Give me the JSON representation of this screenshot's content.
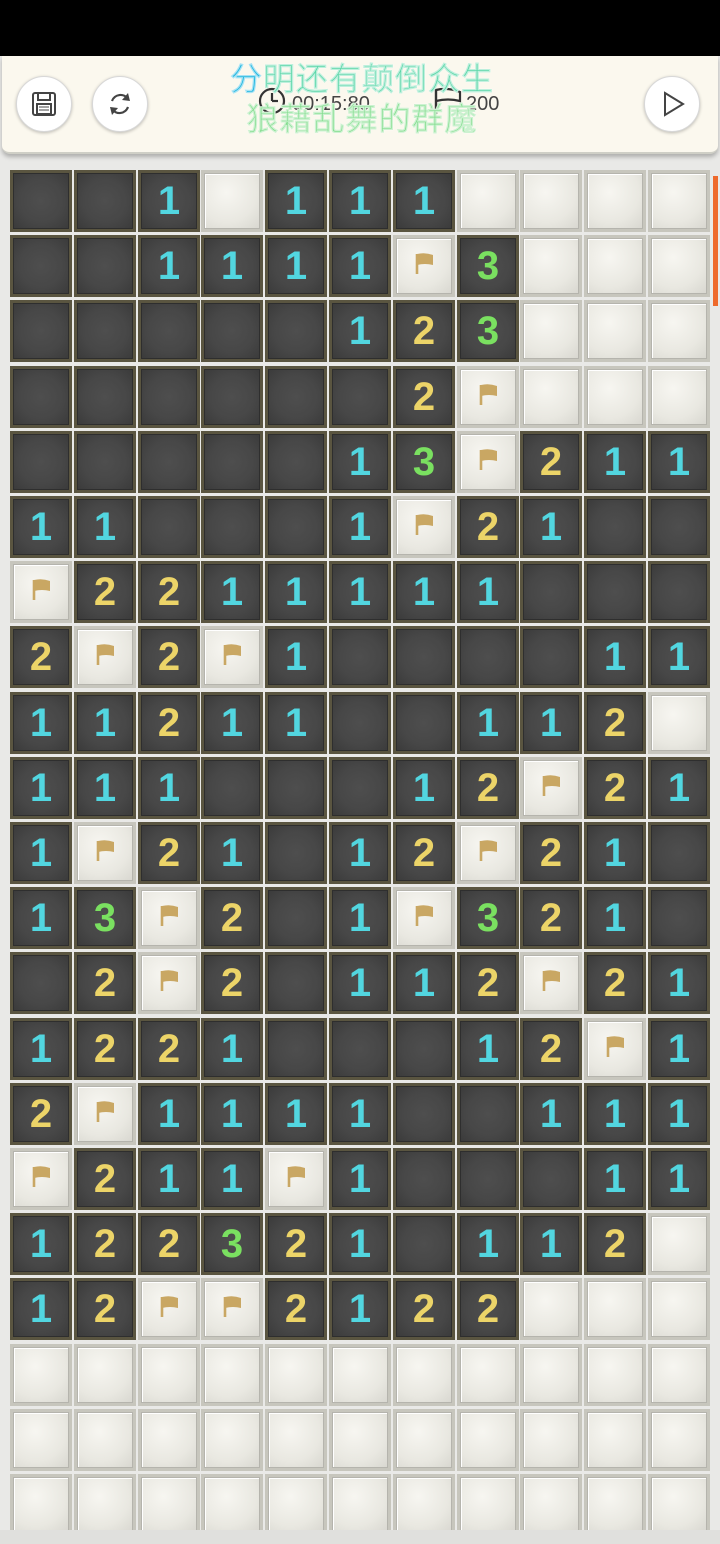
{
  "banner": {
    "line1_highlight": "分",
    "line1_rest": "明还有颠倒众生",
    "line2": "狼藉乱舞的群魔"
  },
  "status": {
    "timer": "00:15:80",
    "flags": "200"
  },
  "icons": {
    "save": "save-icon",
    "restart": "restart-icon",
    "flag": "flag-icon",
    "clock": "clock-icon",
    "play": "play-icon"
  },
  "colors": {
    "num1": "#52d6e0",
    "num2": "#ecd468",
    "num3": "#7ae060",
    "flag": "#c9a763",
    "scroll": "#ee6a2c"
  },
  "board": {
    "cols": 11,
    "rows": [
      [
        ".",
        ".",
        "1",
        "#",
        "1",
        "1",
        "1",
        "#",
        "#",
        "#",
        "#"
      ],
      [
        ".",
        ".",
        "1",
        "1",
        "1",
        "1",
        "F",
        "3",
        "#",
        "#",
        "#"
      ],
      [
        ".",
        ".",
        ".",
        ".",
        ".",
        "1",
        "2",
        "3",
        "#",
        "#",
        "#"
      ],
      [
        ".",
        ".",
        ".",
        ".",
        ".",
        ".",
        "2",
        "F",
        "#",
        "#",
        "#"
      ],
      [
        ".",
        ".",
        ".",
        ".",
        ".",
        "1",
        "3",
        "F",
        "2",
        "1",
        "1"
      ],
      [
        "1",
        "1",
        ".",
        ".",
        ".",
        "1",
        "F",
        "2",
        "1",
        ".",
        "."
      ],
      [
        "F",
        "2",
        "2",
        "1",
        "1",
        "1",
        "1",
        "1",
        ".",
        ".",
        "."
      ],
      [
        "2",
        "F",
        "2",
        "F",
        "1",
        ".",
        ".",
        ".",
        ".",
        "1",
        "1"
      ],
      [
        "1",
        "1",
        "2",
        "1",
        "1",
        ".",
        ".",
        "1",
        "1",
        "2",
        "#"
      ],
      [
        "1",
        "1",
        "1",
        ".",
        ".",
        ".",
        "1",
        "2",
        "F",
        "2",
        "1"
      ],
      [
        "1",
        "F",
        "2",
        "1",
        ".",
        "1",
        "2",
        "F",
        "2",
        "1",
        "."
      ],
      [
        "1",
        "3",
        "F",
        "2",
        ".",
        "1",
        "F",
        "3",
        "2",
        "1",
        "."
      ],
      [
        ".",
        "2",
        "F",
        "2",
        ".",
        "1",
        "1",
        "2",
        "F",
        "2",
        "1"
      ],
      [
        "1",
        "2",
        "2",
        "1",
        ".",
        ".",
        ".",
        "1",
        "2",
        "F",
        "1"
      ],
      [
        "2",
        "F",
        "1",
        "1",
        "1",
        "1",
        ".",
        ".",
        "1",
        "1",
        "1"
      ],
      [
        "F",
        "2",
        "1",
        "1",
        "F",
        "1",
        ".",
        ".",
        ".",
        "1",
        "1"
      ],
      [
        "1",
        "2",
        "2",
        "3",
        "2",
        "1",
        ".",
        "1",
        "1",
        "2",
        "#"
      ],
      [
        "1",
        "2",
        "F",
        "F",
        "2",
        "1",
        "2",
        "2",
        "#",
        "#",
        "#"
      ],
      [
        "#",
        "#",
        "#",
        "#",
        "#",
        "#",
        "#",
        "#",
        "#",
        "#",
        "#"
      ],
      [
        "#",
        "#",
        "#",
        "#",
        "#",
        "#",
        "#",
        "#",
        "#",
        "#",
        "#"
      ],
      [
        "#",
        "#",
        "#",
        "#",
        "#",
        "#",
        "#",
        "#",
        "#",
        "#",
        "#"
      ]
    ]
  }
}
